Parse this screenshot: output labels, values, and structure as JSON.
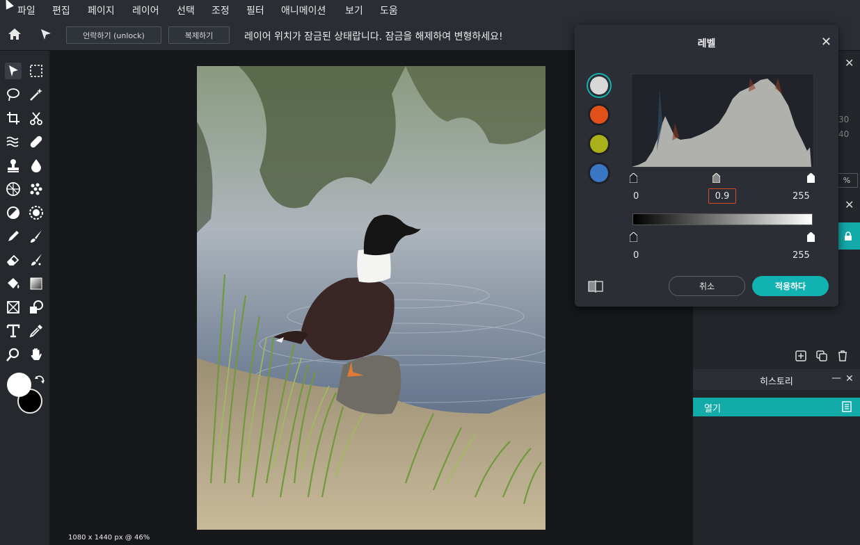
{
  "menu": [
    "파일",
    "편집",
    "페이지",
    "레이어",
    "선택",
    "조정",
    "필터",
    "애니메이션",
    "보기",
    "도움"
  ],
  "toolbar": {
    "unlock_label": "언락하기 (unlock)",
    "duplicate_label": "복제하기",
    "message": "레이어 위치가 잠금된 상태랍니다. 잠금을 해제하여 변형하세요!"
  },
  "status": {
    "text": "1080 x 1440 px @ 46%"
  },
  "levels_dialog": {
    "title": "레벨",
    "input_min": "0",
    "gamma": "0.9",
    "input_max": "255",
    "output_min": "0",
    "output_max": "255",
    "cancel_label": "취소",
    "apply_label": "적용하다",
    "channel_colors": [
      "#d8d8d8",
      "#e2501a",
      "#a9b019",
      "#3a77c2"
    ]
  },
  "history_panel": {
    "title": "히스토리",
    "items": [
      "열기"
    ]
  },
  "right_partial": {
    "num1": "30",
    "num2": "40",
    "pct": "%"
  },
  "colors": {
    "accent": "#13b2b2",
    "primary_swatch": "#ffffff",
    "secondary_swatch": "#000000"
  }
}
